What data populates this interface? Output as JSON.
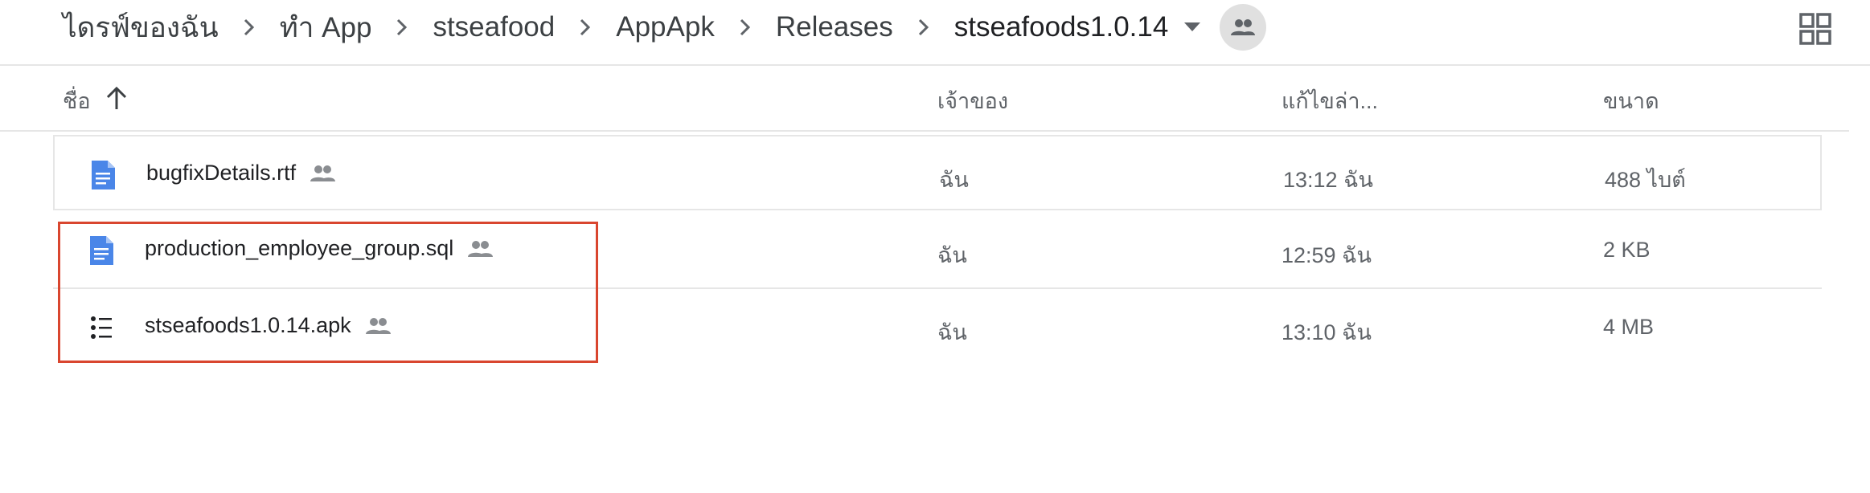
{
  "breadcrumb": {
    "items": [
      {
        "label": "ไดรฟ์ของฉัน"
      },
      {
        "label": "ทำ App"
      },
      {
        "label": "stseafood"
      },
      {
        "label": "AppApk"
      },
      {
        "label": "Releases"
      },
      {
        "label": "stseafoods1.0.14"
      }
    ]
  },
  "columns": {
    "name": "ชื่อ",
    "owner": "เจ้าของ",
    "modified": "แก้ไขล่า...",
    "size": "ขนาด"
  },
  "files": [
    {
      "name": "bugfixDetails.rtf",
      "icon": "document-icon",
      "owner": "ฉัน",
      "modified": "13:12 ฉัน",
      "size": "488 ไบต์"
    },
    {
      "name": "production_employee_group.sql",
      "icon": "document-icon",
      "owner": "ฉัน",
      "modified": "12:59 ฉัน",
      "size": "2 KB"
    },
    {
      "name": "stseafoods1.0.14.apk",
      "icon": "list-file-icon",
      "owner": "ฉัน",
      "modified": "13:10 ฉัน",
      "size": "4 MB"
    }
  ],
  "colors": {
    "doc_icon": "#4a86e8",
    "highlight_border": "#d9462f",
    "secondary_text": "#5f6368"
  }
}
